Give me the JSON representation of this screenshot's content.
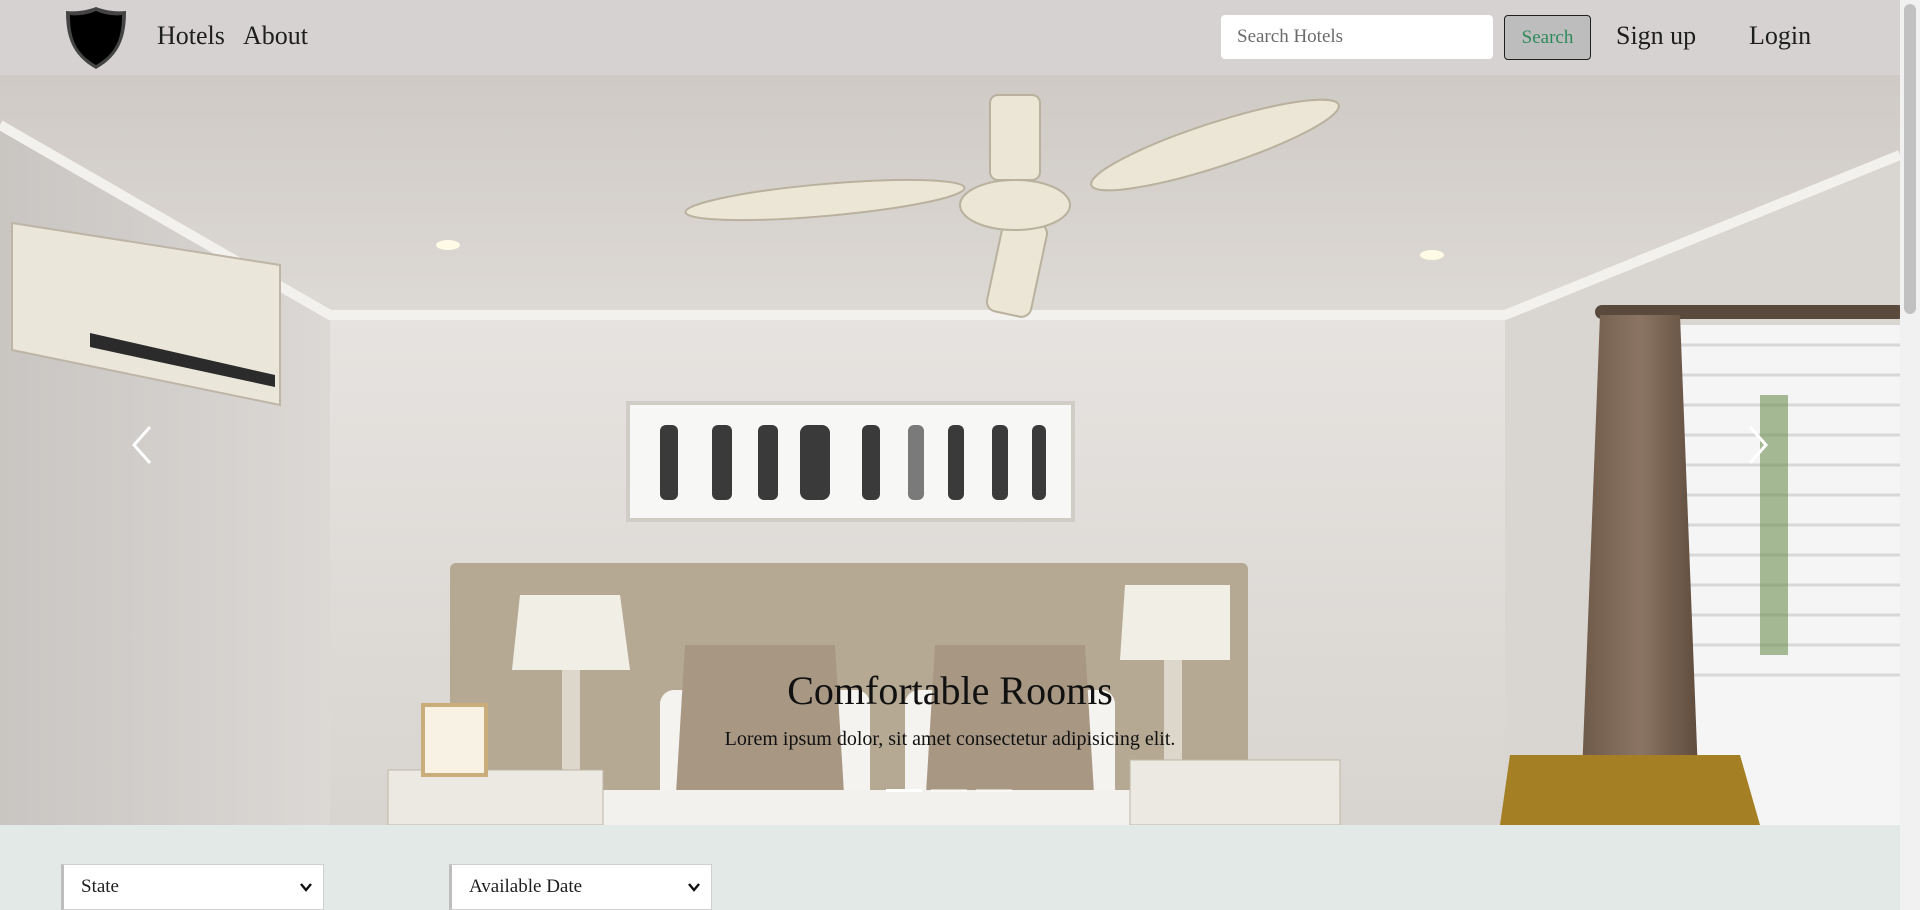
{
  "nav": {
    "links": [
      "Hotels",
      "About"
    ],
    "search_placeholder": "Search Hotels",
    "search_button": "Search",
    "signup": "Sign up",
    "login": "Login"
  },
  "carousel": {
    "caption_title": "Comfortable Rooms",
    "caption_text": "Lorem ipsum dolor, sit amet consectetur adipisicing elit.",
    "slide_count": 3,
    "active_slide": 1
  },
  "filters": {
    "state_selected": "State",
    "date_selected": "Available Date"
  },
  "colors": {
    "navbar_bg": "#d5d2d1",
    "search_text": "#2f8a5b",
    "page_bg": "#e3e9e6"
  }
}
